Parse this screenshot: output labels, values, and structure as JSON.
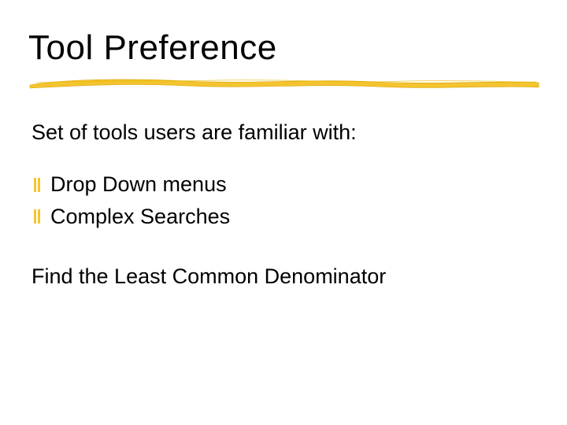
{
  "slide": {
    "title": "Tool Preference",
    "intro": "Set of tools users are familiar with:",
    "bullets": [
      {
        "label": "Drop Down menus"
      },
      {
        "label": "Complex Searches"
      }
    ],
    "closing": "Find the Least Common Denominator"
  },
  "colors": {
    "accent": "#f4c430",
    "accent_dark": "#d9a400"
  }
}
